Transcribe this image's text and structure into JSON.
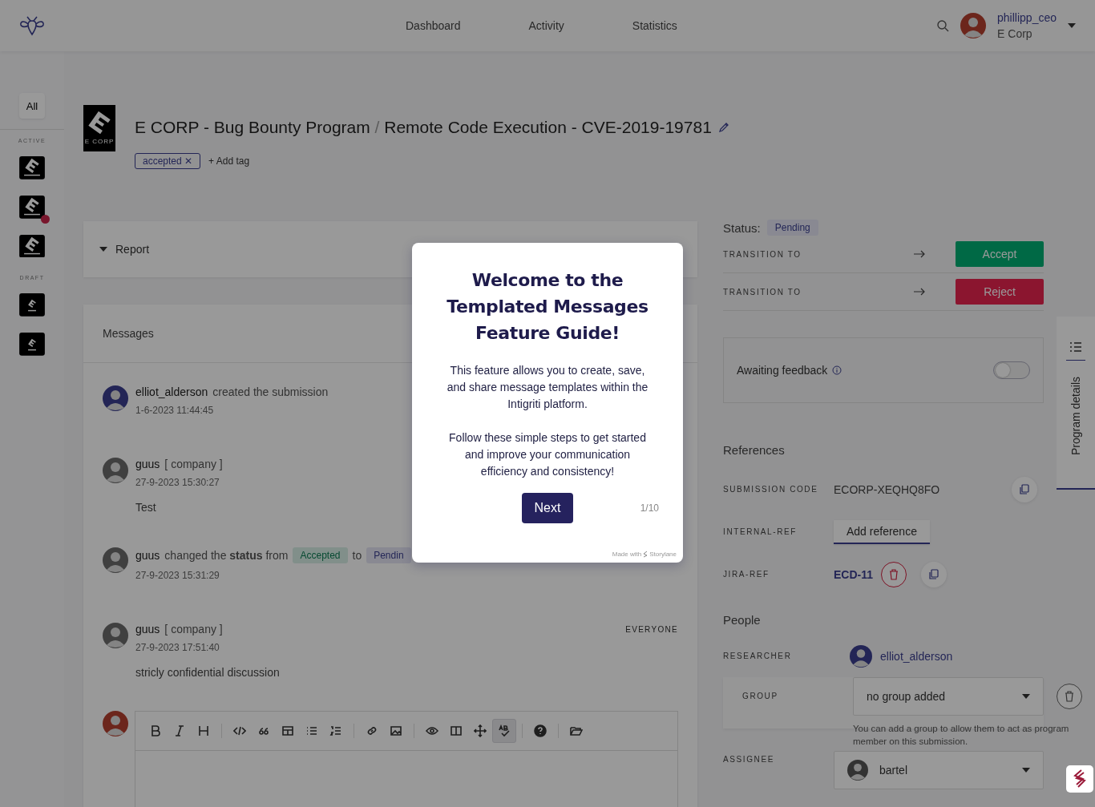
{
  "nav": {
    "links": [
      {
        "label": "Dashboard",
        "selected": false
      },
      {
        "label": "Activity",
        "selected": false
      },
      {
        "label": "Statistics",
        "selected": false
      }
    ],
    "user": {
      "name": "phillipp_ceo",
      "org": "E Corp"
    }
  },
  "sidebar": {
    "all": "All",
    "sections": [
      {
        "label": "ACTIVE",
        "programs": [
          {
            "kind": "large",
            "notification": false
          },
          {
            "kind": "large",
            "notification": true
          },
          {
            "kind": "large",
            "notification": false
          }
        ]
      },
      {
        "label": "DRAFT",
        "programs": [
          {
            "kind": "small",
            "notification": false
          },
          {
            "kind": "small",
            "notification": false
          }
        ]
      }
    ]
  },
  "header": {
    "logo_text": "E CORP",
    "program": "E CORP - Bug Bounty Program",
    "separator": "/",
    "title": "Remote Code Execution - CVE-2019-19781",
    "tags": [
      {
        "label": "accepted",
        "remove": "✕"
      }
    ],
    "add_tag": "+ Add tag"
  },
  "report": {
    "label": "Report",
    "expanded": false
  },
  "messages": {
    "title": "Messages",
    "items": [
      {
        "kind": "event",
        "author": "elliot_alderson",
        "text": "created the submission",
        "time": "1-6-2023 11:44:45"
      },
      {
        "kind": "comment",
        "author": "guus",
        "role": "[ company ]",
        "time": "27-9-2023 15:30:27",
        "body": "Test"
      },
      {
        "kind": "status",
        "author": "guus",
        "text": "changed the **status** from",
        "from": "Accepted",
        "to_word": "to",
        "to": "Pendin",
        "time": "27-9-2023 15:31:29"
      },
      {
        "kind": "comment",
        "author": "guus",
        "role": "[ company ]",
        "time": "27-9-2023 17:51:40",
        "body": "stricly confidential discussion",
        "audience": "EVERYONE"
      }
    ]
  },
  "editor": {
    "toolbar": [
      {
        "kind": "bold",
        "selected": false
      },
      {
        "kind": "italic",
        "selected": false
      },
      {
        "kind": "heading",
        "selected": false
      },
      {
        "kind": "sep"
      },
      {
        "kind": "code",
        "selected": false
      },
      {
        "kind": "quote",
        "selected": false
      },
      {
        "kind": "table",
        "selected": false
      },
      {
        "kind": "bullets",
        "selected": false
      },
      {
        "kind": "numbers",
        "selected": false
      },
      {
        "kind": "sep"
      },
      {
        "kind": "link",
        "selected": false
      },
      {
        "kind": "image",
        "selected": false
      },
      {
        "kind": "sep"
      },
      {
        "kind": "preview",
        "selected": false
      },
      {
        "kind": "side",
        "selected": false
      },
      {
        "kind": "fullscreen",
        "selected": false
      },
      {
        "kind": "spell",
        "selected": true
      },
      {
        "kind": "sep"
      },
      {
        "kind": "help",
        "selected": false
      },
      {
        "kind": "sep"
      },
      {
        "kind": "folder",
        "selected": false
      }
    ]
  },
  "status": {
    "label": "Status:",
    "value": "Pending",
    "transitions": [
      {
        "label": "TRANSITION TO",
        "action": "Accept",
        "kind": "accept"
      },
      {
        "label": "TRANSITION TO",
        "action": "Reject",
        "kind": "reject"
      }
    ]
  },
  "awaiting": {
    "label": "Awaiting feedback",
    "on": false
  },
  "references": {
    "title": "References",
    "rows": [
      {
        "label": "SUBMISSION CODE",
        "kind": "code",
        "value": "ECORP-XEQHQ8FO"
      },
      {
        "label": "INTERNAL-REF",
        "kind": "button",
        "value": "Add reference"
      },
      {
        "label": "JIRA-REF",
        "kind": "link",
        "value": "ECD-11"
      }
    ]
  },
  "people": {
    "title": "People",
    "researcher": {
      "label": "RESEARCHER",
      "name": "elliot_alderson"
    },
    "group": {
      "label": "GROUP",
      "value": "no group added",
      "help": "You can add a group to allow them to act as program member on this submission."
    },
    "assignee": {
      "label": "ASSIGNEE",
      "value": "bartel"
    }
  },
  "side_tab": {
    "label": "Program details"
  },
  "modal": {
    "title": "Welcome to the Templated Messages Feature Guide!",
    "paragraphs": [
      "This feature allows you to create, save, and share message templates within the Intigriti platform.",
      "Follow these simple steps to get started and improve your communication efficiency and consistency!"
    ],
    "button": "Next",
    "step": "1/10",
    "credit": "Made with",
    "brand": "Storylane"
  }
}
